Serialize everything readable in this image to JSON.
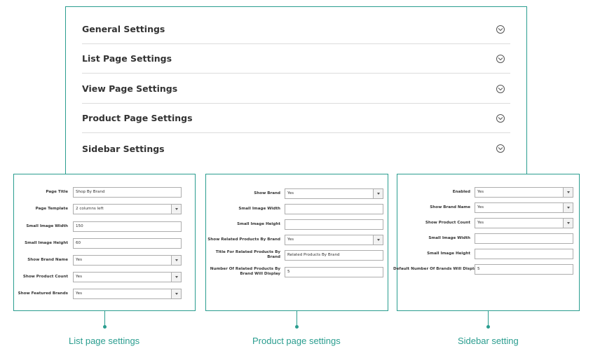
{
  "sections": [
    {
      "title": "General Settings"
    },
    {
      "title": "List Page Settings"
    },
    {
      "title": "View Page Settings"
    },
    {
      "title": "Product Page Settings"
    },
    {
      "title": "Sidebar Settings"
    }
  ],
  "list_page": {
    "caption": "List page settings",
    "fields": [
      {
        "label": "Page Title",
        "value": "Shop By Brand",
        "type": "text"
      },
      {
        "label": "Page Template",
        "value": "2 columns left",
        "type": "select"
      },
      {
        "label": "Small Image Width",
        "value": "150",
        "type": "text"
      },
      {
        "label": "Small Image Height",
        "value": "60",
        "type": "text"
      },
      {
        "label": "Show Brand Name",
        "value": "Yes",
        "type": "select"
      },
      {
        "label": "Show Product Count",
        "value": "Yes",
        "type": "select"
      },
      {
        "label": "Show Featured Brands",
        "value": "Yes",
        "type": "select"
      }
    ]
  },
  "product_page": {
    "caption": "Product page settings",
    "fields": [
      {
        "label": "Show Brand",
        "value": "Yes",
        "type": "select"
      },
      {
        "label": "Small Image Width",
        "value": "",
        "type": "text"
      },
      {
        "label": "Small Image Height",
        "value": "",
        "type": "text"
      },
      {
        "label": "Show Related Products By Brand",
        "value": "Yes",
        "type": "select"
      },
      {
        "label": "Title For Related Products By Brand",
        "value": "Related Products By Brand",
        "type": "text"
      },
      {
        "label": "Number Of Related Products By Brand Will Display",
        "value": "5",
        "type": "text"
      }
    ]
  },
  "sidebar": {
    "caption": "Sidebar setting",
    "fields": [
      {
        "label": "Enabled",
        "value": "Yes",
        "type": "select"
      },
      {
        "label": "Show Brand Name",
        "value": "Yes",
        "type": "select"
      },
      {
        "label": "Show Product Count",
        "value": "Yes",
        "type": "select"
      },
      {
        "label": "Small Image Width",
        "value": "",
        "type": "text"
      },
      {
        "label": "Small Image Height",
        "value": "",
        "type": "text"
      },
      {
        "label": "Default Number Of Brands Will Display",
        "value": "5",
        "type": "text"
      }
    ]
  },
  "colors": {
    "accent": "#2a9d8f",
    "border": "#adadad",
    "text": "#333333"
  },
  "icons": {
    "section_toggle": "chevron-down-circle-icon",
    "select_arrow": "triangle-down-icon"
  }
}
